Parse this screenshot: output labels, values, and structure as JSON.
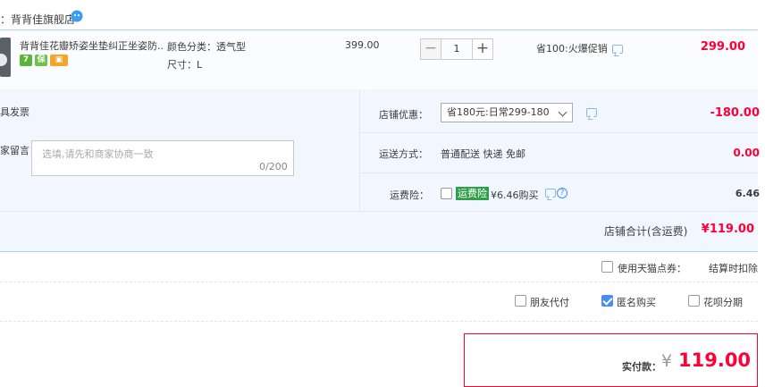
{
  "shop": {
    "label": "：背背佳旗舰店",
    "icon": "wangwang-chat-icon"
  },
  "item": {
    "title": "背背佳花瓣矫姿坐垫纠正坐姿防...",
    "sku_color": "颜色分类：透气型",
    "sku_size": "尺寸：L",
    "unit_price": "399.00",
    "quantity": "1",
    "minus": "−",
    "plus": "+",
    "promo": "省100:火爆促销",
    "total": "299.00",
    "badges": [
      "7",
      "保",
      "▣"
    ]
  },
  "options": {
    "invoice_label": "具发票",
    "message_label": "家留言：",
    "message_placeholder": "选填,请先和商家协商一致",
    "message_count": "0/200",
    "store_discount_label": "店铺优惠：",
    "store_discount_value": "省180元:日常299-180",
    "store_discount_amount": "-180.00",
    "shipping_label": "运送方式：",
    "shipping_value": "普通配送 快递 免邮",
    "shipping_amount": "0.00",
    "insurance_label": "运费险：",
    "insurance_tag": "运费险",
    "insurance_price": "¥6.46购买",
    "insurance_amount": "6.46",
    "help": "?"
  },
  "shop_total": {
    "label": "店铺合计(含运费)",
    "value": "¥119.00"
  },
  "tmall_points": {
    "label": "使用天猫点券：",
    "note": "结算时扣除"
  },
  "payment_options": {
    "friend_pay": "朋友代付",
    "anonymous": "匿名购买",
    "huabei": "花呗分期"
  },
  "pay": {
    "label": "实付款：",
    "currency": "¥",
    "amount": "119.00"
  },
  "colors": {
    "accent_red": "#ff0036",
    "accent_blue": "#4a8df0",
    "panel_bg": "#f2f7ff"
  }
}
